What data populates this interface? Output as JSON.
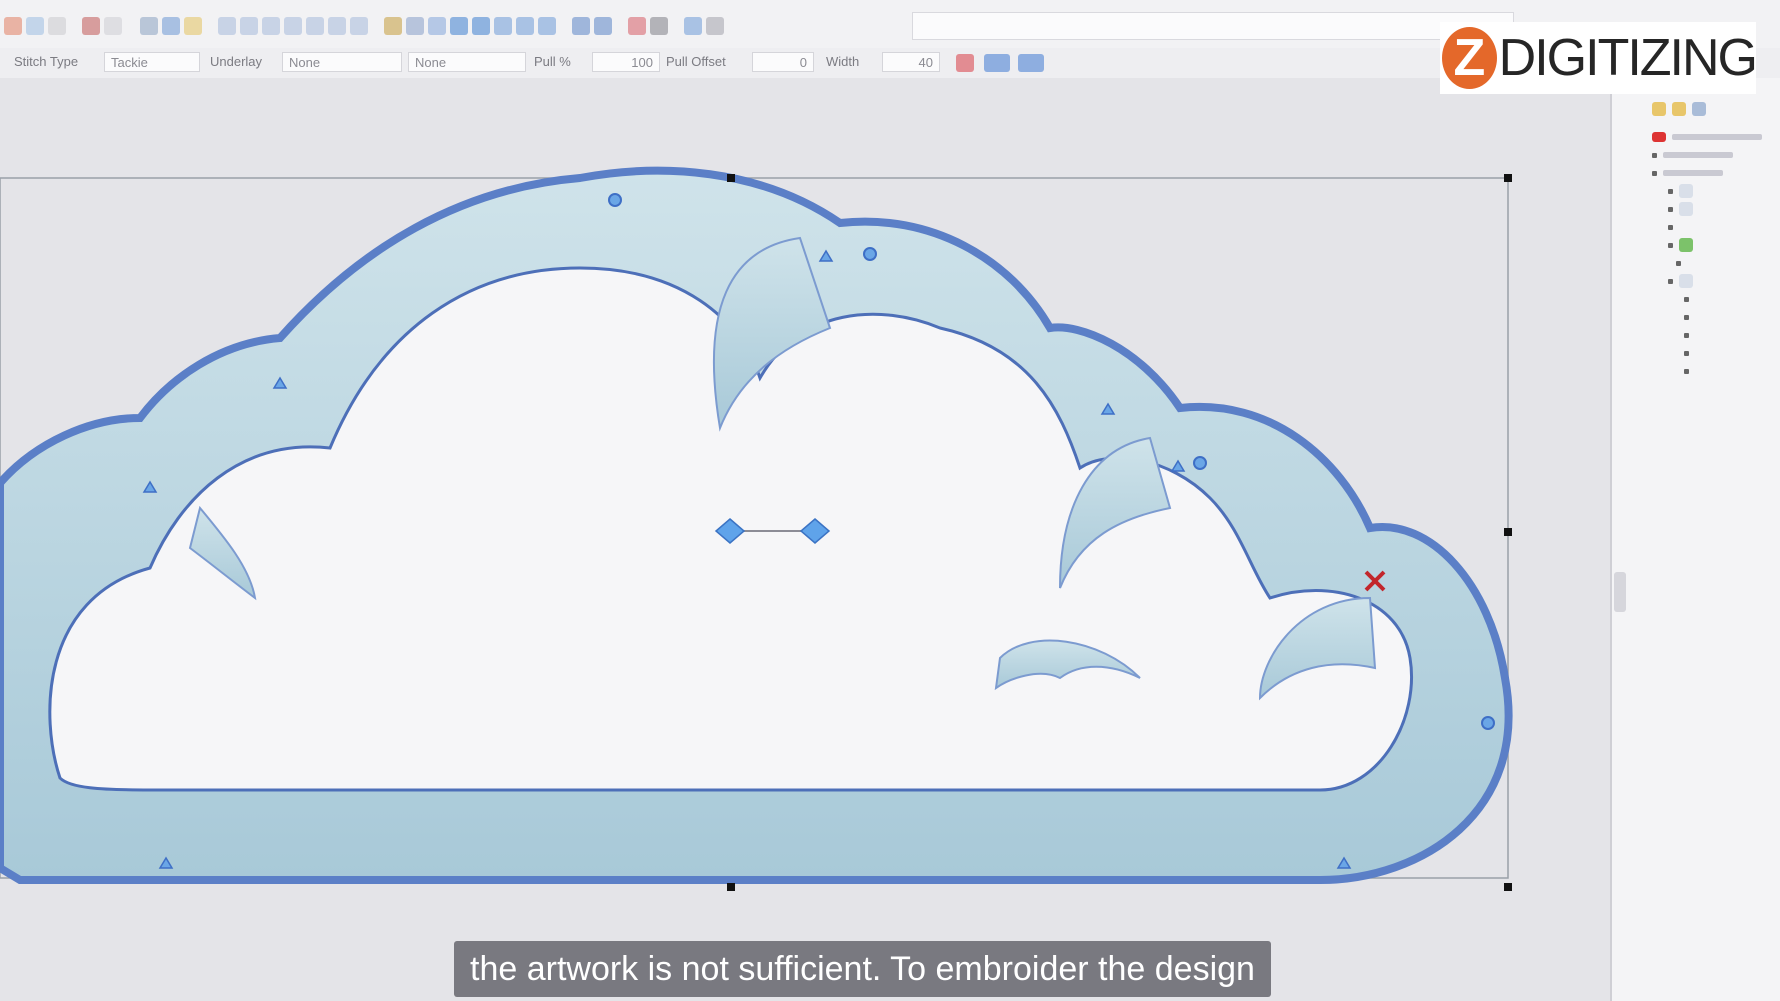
{
  "toolbar": {
    "icons": [
      "cut-icon",
      "copy-icon",
      "paste-icon",
      "undo-icon",
      "redo-icon",
      "print-icon",
      "zoom-icon",
      "zoom-in-icon",
      "zoom-out-icon",
      "pen-icon",
      "select-icon",
      "node-icon",
      "transform-icon",
      "pencil-icon",
      "delete-icon",
      "refresh-icon"
    ]
  },
  "properties": {
    "stitch_type_label": "Stitch Type",
    "stitch_type_value": "Tackie",
    "underlay_label": "Underlay",
    "underlay_value": "None",
    "underlay_value2": "None",
    "pull_label": "Pull %",
    "pull_value": "100",
    "pull_offset_label": "Pull Offset",
    "pull_offset_value": "0",
    "width_label": "Width",
    "width_value": "40"
  },
  "logo": {
    "letter": "Z",
    "text": "DIGITIZING"
  },
  "colors": {
    "stitch_fill": "#bcd7e2",
    "stitch_outline": "#5b7fc7",
    "logo_orange": "#e4682a"
  },
  "subtitle": "the artwork is not sufficient. To embroider the design"
}
